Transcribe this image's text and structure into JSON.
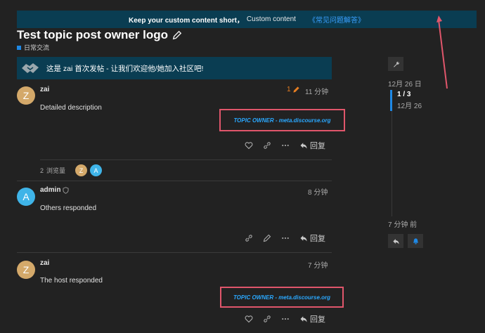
{
  "banner": {
    "strong": "Keep your custom content short，",
    "text": "Custom content",
    "link": "《常见问题解答》"
  },
  "topic": {
    "title": "Test topic post owner logo",
    "category": "日常交流"
  },
  "welcome": {
    "text": "这是 zai 首次发帖 - 让我们欢迎他/她加入社区吧!"
  },
  "posts": [
    {
      "avatar": "Z",
      "username": "zai",
      "edit_count": "1",
      "time": "11 分钟",
      "body": "Detailed description",
      "owner_label": "TOPIC OWNER - meta.discourse.org",
      "reply": "回复"
    },
    {
      "avatar": "A",
      "username": "admin",
      "time": "8 分钟",
      "body": "Others responded",
      "reply": "回复"
    },
    {
      "avatar": "Z",
      "username": "zai",
      "time": "7 分钟",
      "body": "The host responded",
      "owner_label": "TOPIC OWNER - meta.discourse.org",
      "reply": "回复"
    }
  ],
  "views": {
    "count": "2",
    "label": "浏览量",
    "avatars": [
      "Z",
      "A"
    ]
  },
  "timeline": {
    "start_date": "12月 26 日",
    "position": "1 / 3",
    "position_date": "12月 26",
    "end": "7 分钟 前"
  },
  "colors": {
    "banner_bg": "#0a3d52",
    "accent": "#1e88e5",
    "highlight_box": "#e0566b",
    "owner_text": "#2aa8ff",
    "edit_orange": "#e67e22"
  }
}
